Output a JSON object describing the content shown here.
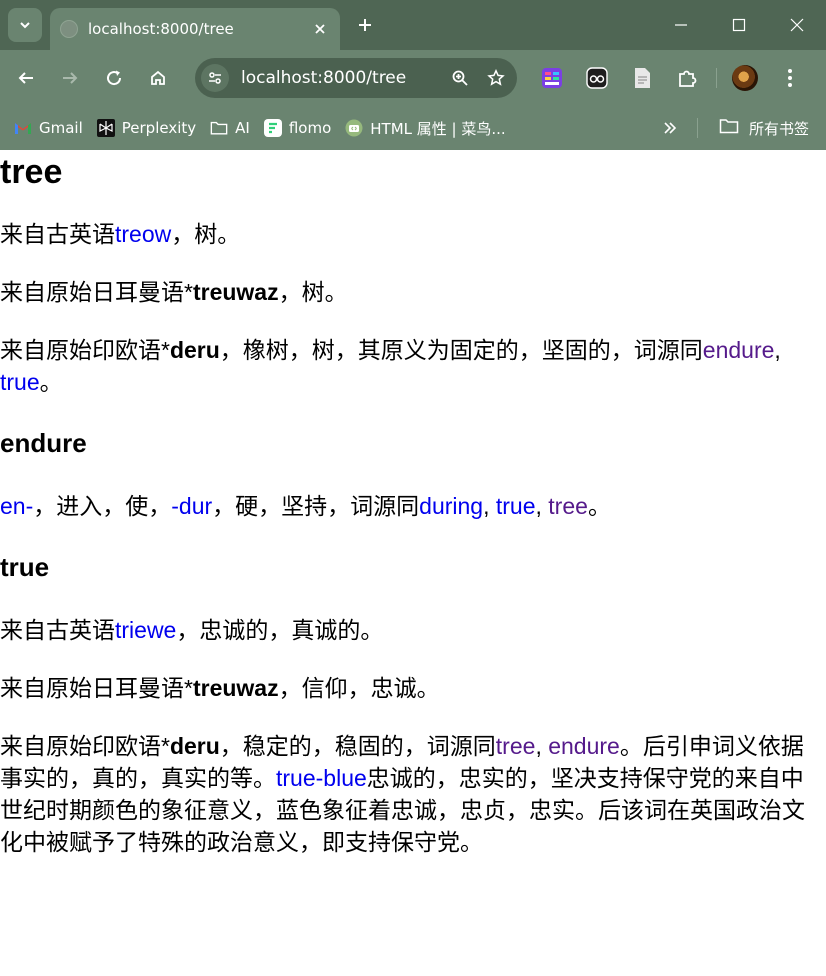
{
  "browser": {
    "tab_title": "localhost:8000/tree",
    "url": "localhost:8000/tree",
    "bookmarks": [
      "Gmail",
      "Perplexity",
      "AI",
      "flomo",
      "HTML 属性 | 菜鸟..."
    ],
    "all_bookmarks_label": "所有书签",
    "icons": [
      "search-tabs-icon",
      "globe-icon",
      "close-icon",
      "plus-icon",
      "minimize-icon",
      "maximize-icon",
      "close-window-icon",
      "back-icon",
      "forward-icon",
      "reload-icon",
      "home-icon",
      "site-info-icon",
      "zoom-icon",
      "star-icon",
      "extension-icons",
      "puzzle-icon",
      "menu-icon",
      "folder-icon",
      "chevron-double-right-icon"
    ]
  },
  "page": {
    "title": "tree",
    "tree": {
      "p1": {
        "pre": "来自古英语",
        "link": "treow",
        "post": "，树。"
      },
      "p2": {
        "pre": "来自原始日耳曼语*",
        "bold": "treuwaz",
        "post": "，树。"
      },
      "p3": {
        "pre": "来自原始印欧语*",
        "bold": "deru",
        "mid": "，橡树，树，其原义为固定的，坚固的，词源同",
        "link1": "endure",
        "sep": ", ",
        "link2": "true",
        "post": "。"
      }
    },
    "endure": {
      "heading": "endure",
      "link1": "en-",
      "t1": "，进入，使，",
      "link2": "-dur",
      "t2": "，硬，坚持，词源同",
      "link3": "during",
      "sep1": ", ",
      "link4": "true",
      "sep2": ", ",
      "link5": "tree",
      "post": "。"
    },
    "true": {
      "heading": "true",
      "p1": {
        "pre": "来自古英语",
        "link": "triewe",
        "post": "，忠诚的，真诚的。"
      },
      "p2": {
        "pre": "来自原始日耳曼语*",
        "bold": "treuwaz",
        "post": "，信仰，忠诚。"
      },
      "p3": {
        "pre": "来自原始印欧语*",
        "bold": "deru",
        "mid": "，稳定的，稳固的，词源同",
        "link1": "tree",
        "sep": ", ",
        "link2": "endure",
        "mid2": "。后引申词义依据事实的，真的，真实的等。",
        "link3": "true-blue",
        "post": "忠诚的，忠实的，坚决支持保守党的来自中世纪时期颜色的象征意义，蓝色象征着忠诚，忠贞，忠实。后该词在英国政治文化中被赋予了特殊的政治意义，即支持保守党。"
      }
    }
  },
  "colors": {
    "chrome_dark": "#4f6654",
    "chrome": "#6a8470",
    "link": "#0000ee",
    "visited": "#551a8b"
  }
}
